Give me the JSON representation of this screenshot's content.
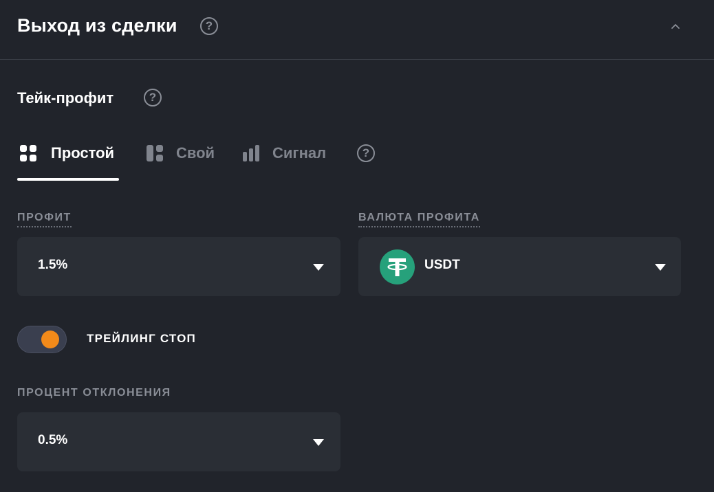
{
  "header": {
    "title": "Выход из сделки",
    "help_icon": "question-circle-icon",
    "collapse_icon": "chevron-up-icon"
  },
  "take_profit": {
    "title": "Тейк-профит",
    "help_icon": "question-circle-icon"
  },
  "tabs": [
    {
      "label": "Простой",
      "icon": "grid-icon",
      "active": true
    },
    {
      "label": "Свой",
      "icon": "layout-icon",
      "active": false
    },
    {
      "label": "Сигнал",
      "icon": "bar-chart-icon",
      "active": false
    }
  ],
  "profit": {
    "label": "ПРОФИТ",
    "value": "1.5%"
  },
  "profit_currency": {
    "label": "ВАЛЮТА ПРОФИТА",
    "value": "USDT",
    "icon": "tether-icon"
  },
  "trailing_stop": {
    "label": "ТРЕЙЛИНГ СТОП",
    "enabled": true
  },
  "deviation": {
    "label": "ПРОЦЕНТ ОТКЛОНЕНИЯ",
    "value": "0.5%"
  },
  "colors": {
    "background": "#21242b",
    "field_background": "#2a2e35",
    "toggle_knob": "#f28a1a",
    "tether_green": "#26a17b",
    "muted_text": "#8a8e97"
  }
}
